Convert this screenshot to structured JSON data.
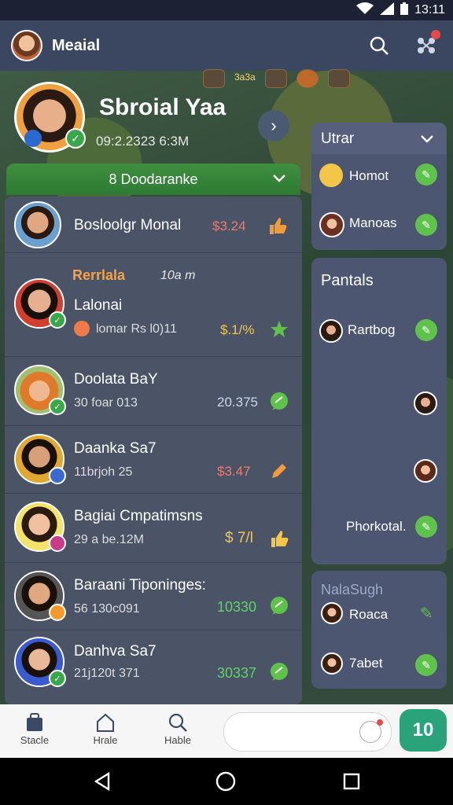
{
  "status": {
    "time": "13:11"
  },
  "appbar": {
    "title": "Meaial"
  },
  "hero": {
    "name": "Sbroial Yaa",
    "subtitle": "09:2.2323 6:3M"
  },
  "game_row": {
    "label": "3a3a"
  },
  "banner": {
    "label": "8 Doodaranke"
  },
  "list": [
    {
      "name": "Bosloolgr Monal",
      "sub": "",
      "value": "$3.24",
      "value_color": "#f07a6a",
      "action_icon": "thumb-icon",
      "action_color": "#f39a3a"
    },
    {
      "header": "Rerrlala",
      "header_time": "10a m",
      "name": "Lalonai",
      "sub": "lomar Rs l0)11",
      "value": "$.1/%",
      "value_color": "#f3c64a",
      "action_icon": "star-icon",
      "action_color": "#5fc24a"
    },
    {
      "name": "Doolata BaY",
      "sub": "30 foar 013",
      "value": "20.375",
      "value_color": "#c8d8f0",
      "action_icon": "chat-icon",
      "action_color": "#5fc24a"
    },
    {
      "name": "Daanka Sa7",
      "sub": "11brjoh 25",
      "value": "$3.47",
      "value_color": "#f07a6a",
      "action_icon": "pencil-icon",
      "action_color": "#f39a3a"
    },
    {
      "name": "Bagiai Cmpatimsns",
      "sub": "29 a be.12M",
      "value": "$ 7/l",
      "value_color": "#f3c64a",
      "action_icon": "thumb-icon",
      "action_color": "#f3c64a"
    },
    {
      "name": "Baraani Tiponinges:",
      "sub": "56 130c091",
      "value": "10330",
      "value_color": "#5fd26a",
      "action_icon": "chat-icon",
      "action_color": "#5fc24a"
    },
    {
      "name": "Danhva Sa7",
      "sub": "21j120t 371",
      "value": "30337",
      "value_color": "#5fd26a",
      "action_icon": "chat-icon",
      "action_color": "#5fc24a"
    }
  ],
  "panel_top": {
    "title": "Utrar",
    "items": [
      "Homot",
      "Manoas"
    ]
  },
  "panel_mid": {
    "title": "Pantals",
    "items": [
      "Rartbog",
      "",
      "",
      "Phorkotal."
    ]
  },
  "panel_bottom": {
    "title": "NalaSugh",
    "items": [
      "Roaca",
      "7abet"
    ]
  },
  "bottomnav": {
    "items": [
      "Stacle",
      "Hrale",
      "Hable"
    ],
    "cta": "10"
  },
  "colors": {
    "accent_green": "#5fc24a",
    "cta": "#2aa37a",
    "appbar": "#3b4660"
  }
}
